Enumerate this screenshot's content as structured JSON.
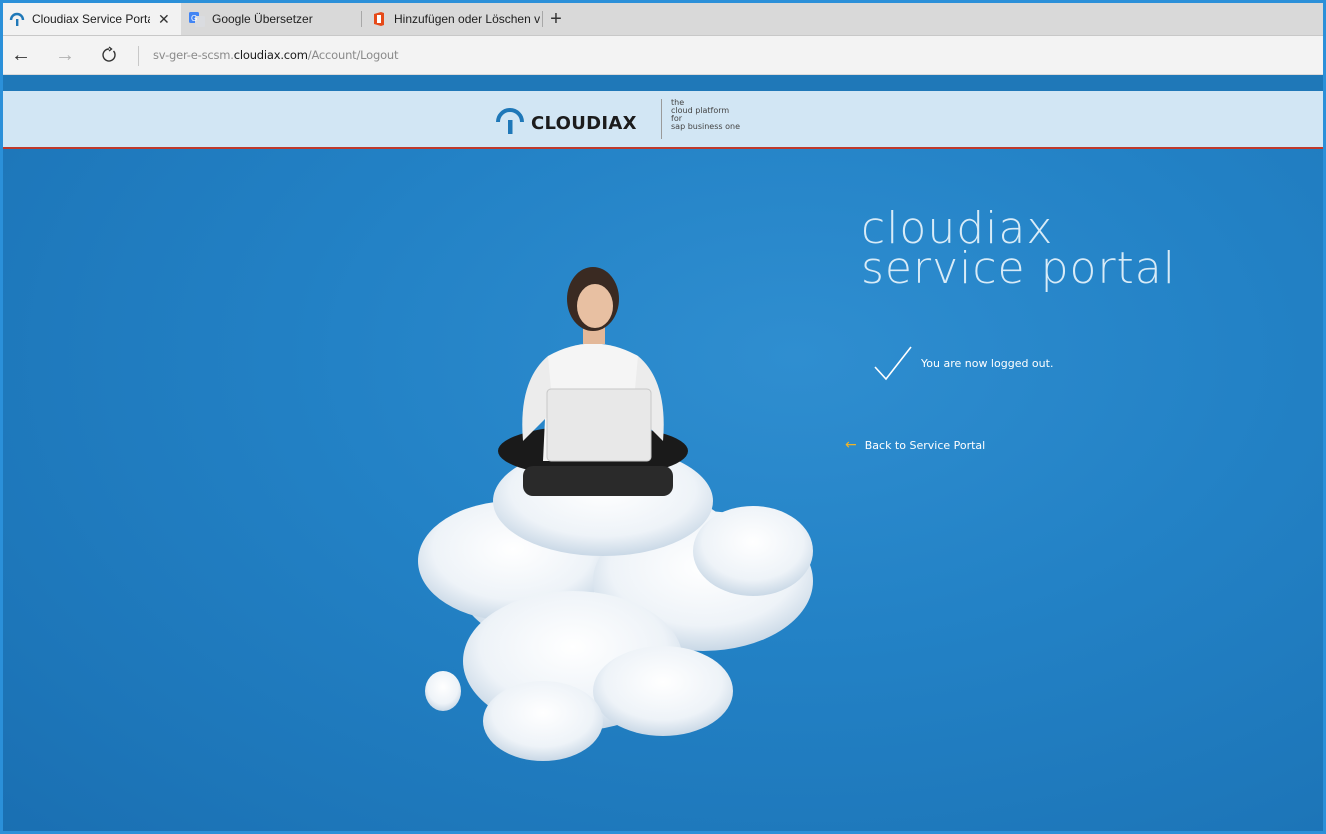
{
  "browser": {
    "tabs": [
      {
        "title": "Cloudiax Service Portal",
        "active": true,
        "icon": "cloudiax-favicon"
      },
      {
        "title": "Google Übersetzer",
        "active": false,
        "icon": "google-translate-favicon"
      },
      {
        "title": "Hinzufügen oder Löschen v",
        "active": false,
        "icon": "office-favicon"
      }
    ],
    "url": {
      "prefix": "sv-ger-e-scsm.",
      "host": "cloudiax.com",
      "path": "/Account/Logout"
    }
  },
  "header": {
    "brand": "CLOUDIAX",
    "tagline": [
      "the",
      "cloud platform",
      "for",
      "sap business one"
    ]
  },
  "main": {
    "title_line1": "cloudiax",
    "title_line2": "service portal",
    "status_message": "You are now logged out.",
    "back_link": "Back to Service Portal"
  },
  "colors": {
    "hero_bg": "#1b7bc0",
    "header_bg": "#d2e6f4",
    "accent_red": "#c0392b",
    "arrow_yellow": "#f0b429"
  }
}
